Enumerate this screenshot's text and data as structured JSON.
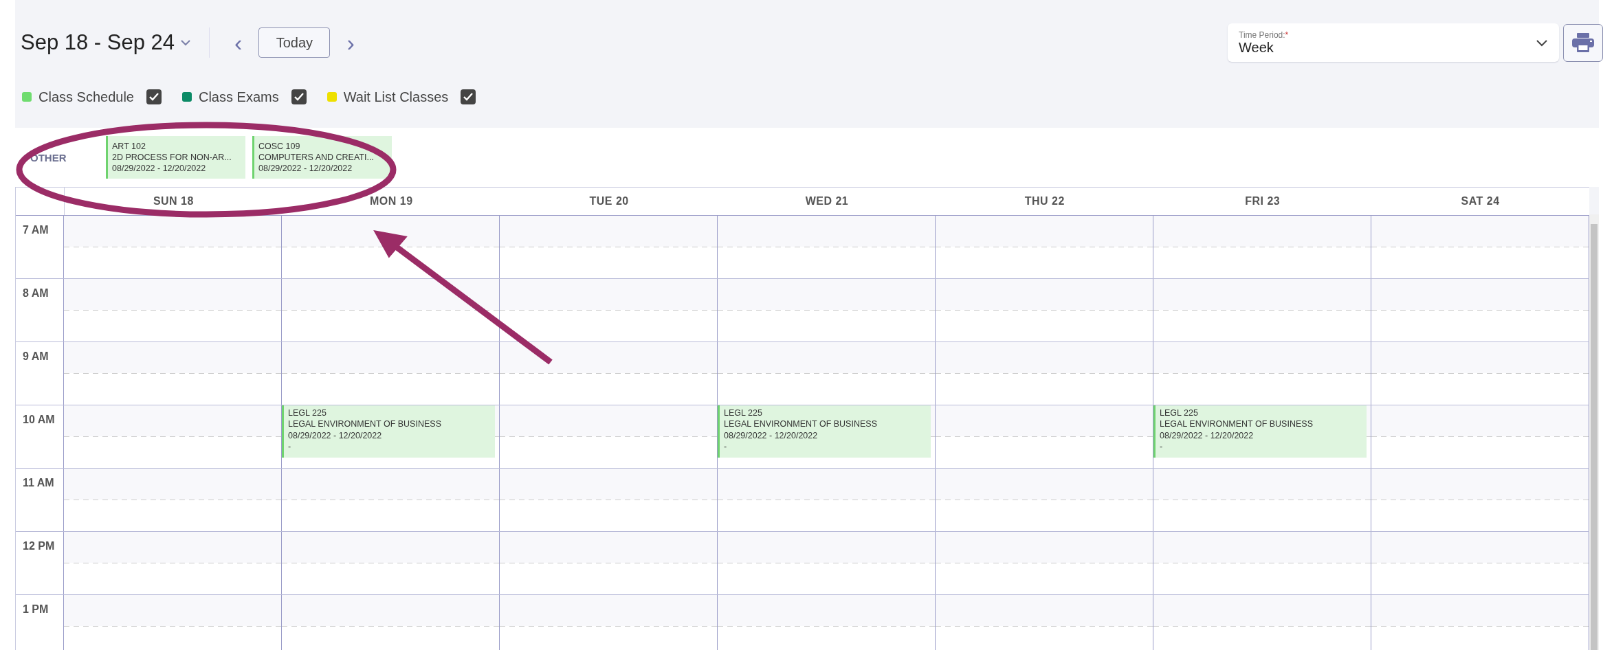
{
  "header": {
    "date_range": "Sep 18 - Sep 24",
    "prev_button": "‹",
    "today_button": "Today",
    "next_button": "›"
  },
  "time_period": {
    "label": "Time Period:",
    "required_mark": "*",
    "value": "Week"
  },
  "legend": [
    {
      "label": "Class Schedule",
      "color": "#6fdc6f",
      "checked": true
    },
    {
      "label": "Class Exams",
      "color": "#0b8a66",
      "checked": true
    },
    {
      "label": "Wait List Classes",
      "color": "#eee000",
      "checked": true
    }
  ],
  "other_row": {
    "label": "OTHER",
    "events": [
      {
        "code": "ART 102",
        "title": "2D PROCESS FOR NON-AR...",
        "dates": "08/29/2022 - 12/20/2022"
      },
      {
        "code": "COSC 109",
        "title": "COMPUTERS AND CREATI...",
        "dates": "08/29/2022 - 12/20/2022"
      }
    ]
  },
  "days": [
    "SUN 18",
    "MON 19",
    "TUE 20",
    "WED 21",
    "THU 22",
    "FRI 23",
    "SAT 24"
  ],
  "rows": [
    {
      "label": "7 AM"
    },
    {
      "label": "8 AM"
    },
    {
      "label": "9 AM"
    },
    {
      "label": "10 AM",
      "cells": [
        null,
        {
          "code": "LEGL 225",
          "title": "LEGAL ENVIRONMENT OF BUSINESS",
          "dates": "08/29/2022 - 12/20/2022",
          "room": "-"
        },
        null,
        {
          "code": "LEGL 225",
          "title": "LEGAL ENVIRONMENT OF BUSINESS",
          "dates": "08/29/2022 - 12/20/2022",
          "room": "-"
        },
        null,
        {
          "code": "LEGL 225",
          "title": "LEGAL ENVIRONMENT OF BUSINESS",
          "dates": "08/29/2022 - 12/20/2022",
          "room": "-"
        },
        null
      ]
    },
    {
      "label": "11 AM"
    },
    {
      "label": "12 PM"
    },
    {
      "label": "1 PM"
    }
  ]
}
